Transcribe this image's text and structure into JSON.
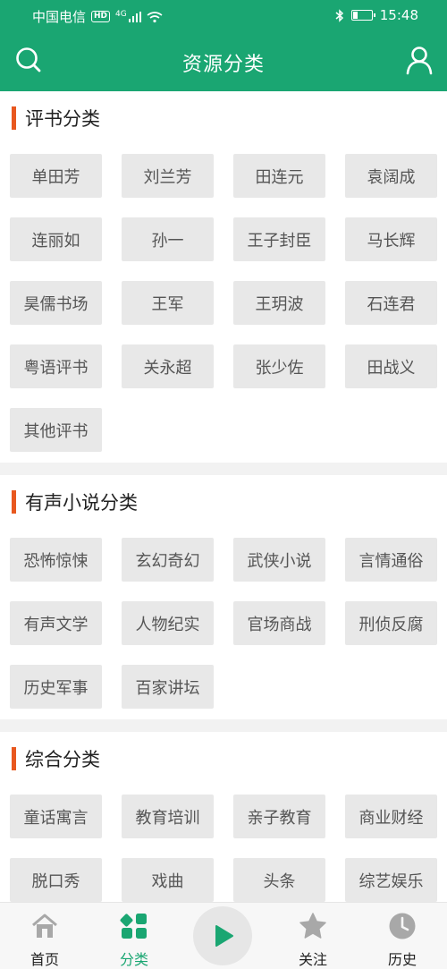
{
  "status_bar": {
    "carrier": "中国电信",
    "hd": "HD",
    "network": "4G",
    "time": "15:48",
    "battery_level": 0.25
  },
  "nav": {
    "title": "资源分类",
    "search_icon": "search-icon",
    "user_icon": "user-icon"
  },
  "sections": [
    {
      "title": "评书分类",
      "tags": [
        "单田芳",
        "刘兰芳",
        "田连元",
        "袁阔成",
        "连丽如",
        "孙一",
        "王子封臣",
        "马长辉",
        "昊儒书场",
        "王军",
        "王玥波",
        "石连君",
        "粤语评书",
        "关永超",
        "张少佐",
        "田战义",
        "其他评书"
      ]
    },
    {
      "title": "有声小说分类",
      "tags": [
        "恐怖惊悚",
        "玄幻奇幻",
        "武侠小说",
        "言情通俗",
        "有声文学",
        "人物纪实",
        "官场商战",
        "刑侦反腐",
        "历史军事",
        "百家讲坛"
      ]
    },
    {
      "title": "综合分类",
      "tags": [
        "童话寓言",
        "教育培训",
        "亲子教育",
        "商业财经",
        "脱口秀",
        "戏曲",
        "头条",
        "综艺娱乐"
      ]
    }
  ],
  "tabbar": {
    "items": [
      {
        "label": "首页",
        "icon": "home-icon",
        "active": false
      },
      {
        "label": "分类",
        "icon": "category-icon",
        "active": true
      },
      {
        "label": "关注",
        "icon": "star-icon",
        "active": false
      },
      {
        "label": "历史",
        "icon": "clock-icon",
        "active": false
      }
    ],
    "play_icon": "play-icon"
  },
  "colors": {
    "brand": "#1aa672",
    "accent": "#e8581f",
    "tag_bg": "#e8e8e8",
    "tab_icon_inactive": "#a8a8a8"
  }
}
